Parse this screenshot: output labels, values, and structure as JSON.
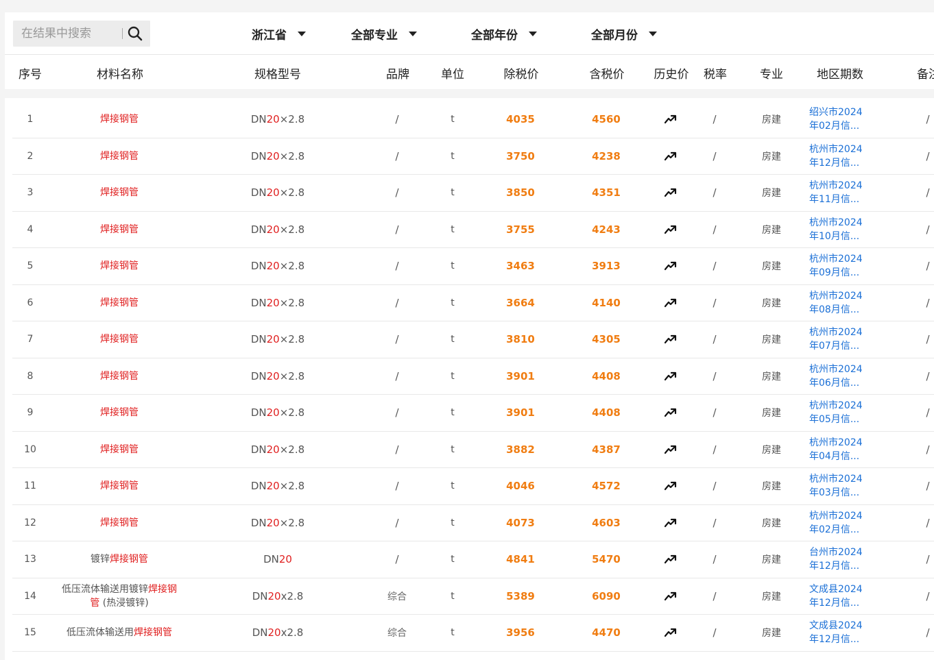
{
  "search": {
    "placeholder": "在结果中搜索"
  },
  "filters": {
    "province": "浙江省",
    "major": "全部专业",
    "year": "全部年份",
    "month": "全部月份"
  },
  "columns": [
    "序号",
    "材料名称",
    "规格型号",
    "品牌",
    "单位",
    "除税价",
    "含税价",
    "历史价",
    "税率",
    "专业",
    "地区期数",
    "备注"
  ],
  "rows": [
    {
      "no": "1",
      "name": [
        {
          "t": "焊接钢管",
          "hl": true
        }
      ],
      "spec": [
        {
          "t": "DN",
          "hl": false
        },
        {
          "t": "20",
          "hl": true
        },
        {
          "t": "×2.8",
          "hl": false
        }
      ],
      "brand": "/",
      "unit": "t",
      "price_ex": "4035",
      "price_inc": "4560",
      "tax": "/",
      "major": "房建",
      "region": "绍兴市2024年02月信...",
      "note": "/"
    },
    {
      "no": "2",
      "name": [
        {
          "t": "焊接钢管",
          "hl": true
        }
      ],
      "spec": [
        {
          "t": "DN",
          "hl": false
        },
        {
          "t": "20",
          "hl": true
        },
        {
          "t": "×2.8",
          "hl": false
        }
      ],
      "brand": "/",
      "unit": "t",
      "price_ex": "3750",
      "price_inc": "4238",
      "tax": "/",
      "major": "房建",
      "region": "杭州市2024年12月信...",
      "note": "/"
    },
    {
      "no": "3",
      "name": [
        {
          "t": "焊接钢管",
          "hl": true
        }
      ],
      "spec": [
        {
          "t": "DN",
          "hl": false
        },
        {
          "t": "20",
          "hl": true
        },
        {
          "t": "×2.8",
          "hl": false
        }
      ],
      "brand": "/",
      "unit": "t",
      "price_ex": "3850",
      "price_inc": "4351",
      "tax": "/",
      "major": "房建",
      "region": "杭州市2024年11月信...",
      "note": "/"
    },
    {
      "no": "4",
      "name": [
        {
          "t": "焊接钢管",
          "hl": true
        }
      ],
      "spec": [
        {
          "t": "DN",
          "hl": false
        },
        {
          "t": "20",
          "hl": true
        },
        {
          "t": "×2.8",
          "hl": false
        }
      ],
      "brand": "/",
      "unit": "t",
      "price_ex": "3755",
      "price_inc": "4243",
      "tax": "/",
      "major": "房建",
      "region": "杭州市2024年10月信...",
      "note": "/"
    },
    {
      "no": "5",
      "name": [
        {
          "t": "焊接钢管",
          "hl": true
        }
      ],
      "spec": [
        {
          "t": "DN",
          "hl": false
        },
        {
          "t": "20",
          "hl": true
        },
        {
          "t": "×2.8",
          "hl": false
        }
      ],
      "brand": "/",
      "unit": "t",
      "price_ex": "3463",
      "price_inc": "3913",
      "tax": "/",
      "major": "房建",
      "region": "杭州市2024年09月信...",
      "note": "/"
    },
    {
      "no": "6",
      "name": [
        {
          "t": "焊接钢管",
          "hl": true
        }
      ],
      "spec": [
        {
          "t": "DN",
          "hl": false
        },
        {
          "t": "20",
          "hl": true
        },
        {
          "t": "×2.8",
          "hl": false
        }
      ],
      "brand": "/",
      "unit": "t",
      "price_ex": "3664",
      "price_inc": "4140",
      "tax": "/",
      "major": "房建",
      "region": "杭州市2024年08月信...",
      "note": "/"
    },
    {
      "no": "7",
      "name": [
        {
          "t": "焊接钢管",
          "hl": true
        }
      ],
      "spec": [
        {
          "t": "DN",
          "hl": false
        },
        {
          "t": "20",
          "hl": true
        },
        {
          "t": "×2.8",
          "hl": false
        }
      ],
      "brand": "/",
      "unit": "t",
      "price_ex": "3810",
      "price_inc": "4305",
      "tax": "/",
      "major": "房建",
      "region": "杭州市2024年07月信...",
      "note": "/"
    },
    {
      "no": "8",
      "name": [
        {
          "t": "焊接钢管",
          "hl": true
        }
      ],
      "spec": [
        {
          "t": "DN",
          "hl": false
        },
        {
          "t": "20",
          "hl": true
        },
        {
          "t": "×2.8",
          "hl": false
        }
      ],
      "brand": "/",
      "unit": "t",
      "price_ex": "3901",
      "price_inc": "4408",
      "tax": "/",
      "major": "房建",
      "region": "杭州市2024年06月信...",
      "note": "/"
    },
    {
      "no": "9",
      "name": [
        {
          "t": "焊接钢管",
          "hl": true
        }
      ],
      "spec": [
        {
          "t": "DN",
          "hl": false
        },
        {
          "t": "20",
          "hl": true
        },
        {
          "t": "×2.8",
          "hl": false
        }
      ],
      "brand": "/",
      "unit": "t",
      "price_ex": "3901",
      "price_inc": "4408",
      "tax": "/",
      "major": "房建",
      "region": "杭州市2024年05月信...",
      "note": "/"
    },
    {
      "no": "10",
      "name": [
        {
          "t": "焊接钢管",
          "hl": true
        }
      ],
      "spec": [
        {
          "t": "DN",
          "hl": false
        },
        {
          "t": "20",
          "hl": true
        },
        {
          "t": "×2.8",
          "hl": false
        }
      ],
      "brand": "/",
      "unit": "t",
      "price_ex": "3882",
      "price_inc": "4387",
      "tax": "/",
      "major": "房建",
      "region": "杭州市2024年04月信...",
      "note": "/"
    },
    {
      "no": "11",
      "name": [
        {
          "t": "焊接钢管",
          "hl": true
        }
      ],
      "spec": [
        {
          "t": "DN",
          "hl": false
        },
        {
          "t": "20",
          "hl": true
        },
        {
          "t": "×2.8",
          "hl": false
        }
      ],
      "brand": "/",
      "unit": "t",
      "price_ex": "4046",
      "price_inc": "4572",
      "tax": "/",
      "major": "房建",
      "region": "杭州市2024年03月信...",
      "note": "/"
    },
    {
      "no": "12",
      "name": [
        {
          "t": "焊接钢管",
          "hl": true
        }
      ],
      "spec": [
        {
          "t": "DN",
          "hl": false
        },
        {
          "t": "20",
          "hl": true
        },
        {
          "t": "×2.8",
          "hl": false
        }
      ],
      "brand": "/",
      "unit": "t",
      "price_ex": "4073",
      "price_inc": "4603",
      "tax": "/",
      "major": "房建",
      "region": "杭州市2024年02月信...",
      "note": "/"
    },
    {
      "no": "13",
      "name": [
        {
          "t": "镀锌",
          "hl": false
        },
        {
          "t": "焊接钢管",
          "hl": true
        }
      ],
      "spec": [
        {
          "t": "DN",
          "hl": false
        },
        {
          "t": "20",
          "hl": true
        }
      ],
      "brand": "/",
      "unit": "t",
      "price_ex": "4841",
      "price_inc": "5470",
      "tax": "/",
      "major": "房建",
      "region": "台州市2024年12月信...",
      "note": "/"
    },
    {
      "no": "14",
      "name": [
        {
          "t": "低压流体输送用镀锌",
          "hl": false
        },
        {
          "t": "焊接钢",
          "hl": true
        },
        {
          "t": "\n",
          "hl": false
        },
        {
          "t": "管",
          "hl": true
        },
        {
          "t": " (热浸镀锌)",
          "hl": false
        }
      ],
      "spec": [
        {
          "t": "DN",
          "hl": false
        },
        {
          "t": "20",
          "hl": true
        },
        {
          "t": "x2.8",
          "hl": false
        }
      ],
      "brand": "综合",
      "unit": "t",
      "price_ex": "5389",
      "price_inc": "6090",
      "tax": "/",
      "major": "房建",
      "region": "文成县2024年12月信...",
      "note": "/"
    },
    {
      "no": "15",
      "name": [
        {
          "t": "低压流体输送用",
          "hl": false
        },
        {
          "t": "焊接钢管",
          "hl": true
        }
      ],
      "spec": [
        {
          "t": "DN",
          "hl": false
        },
        {
          "t": "20",
          "hl": true
        },
        {
          "t": "x2.8",
          "hl": false
        }
      ],
      "brand": "综合",
      "unit": "t",
      "price_ex": "3956",
      "price_inc": "4470",
      "tax": "/",
      "major": "房建",
      "region": "文成县2024年12月信...",
      "note": "/"
    }
  ]
}
